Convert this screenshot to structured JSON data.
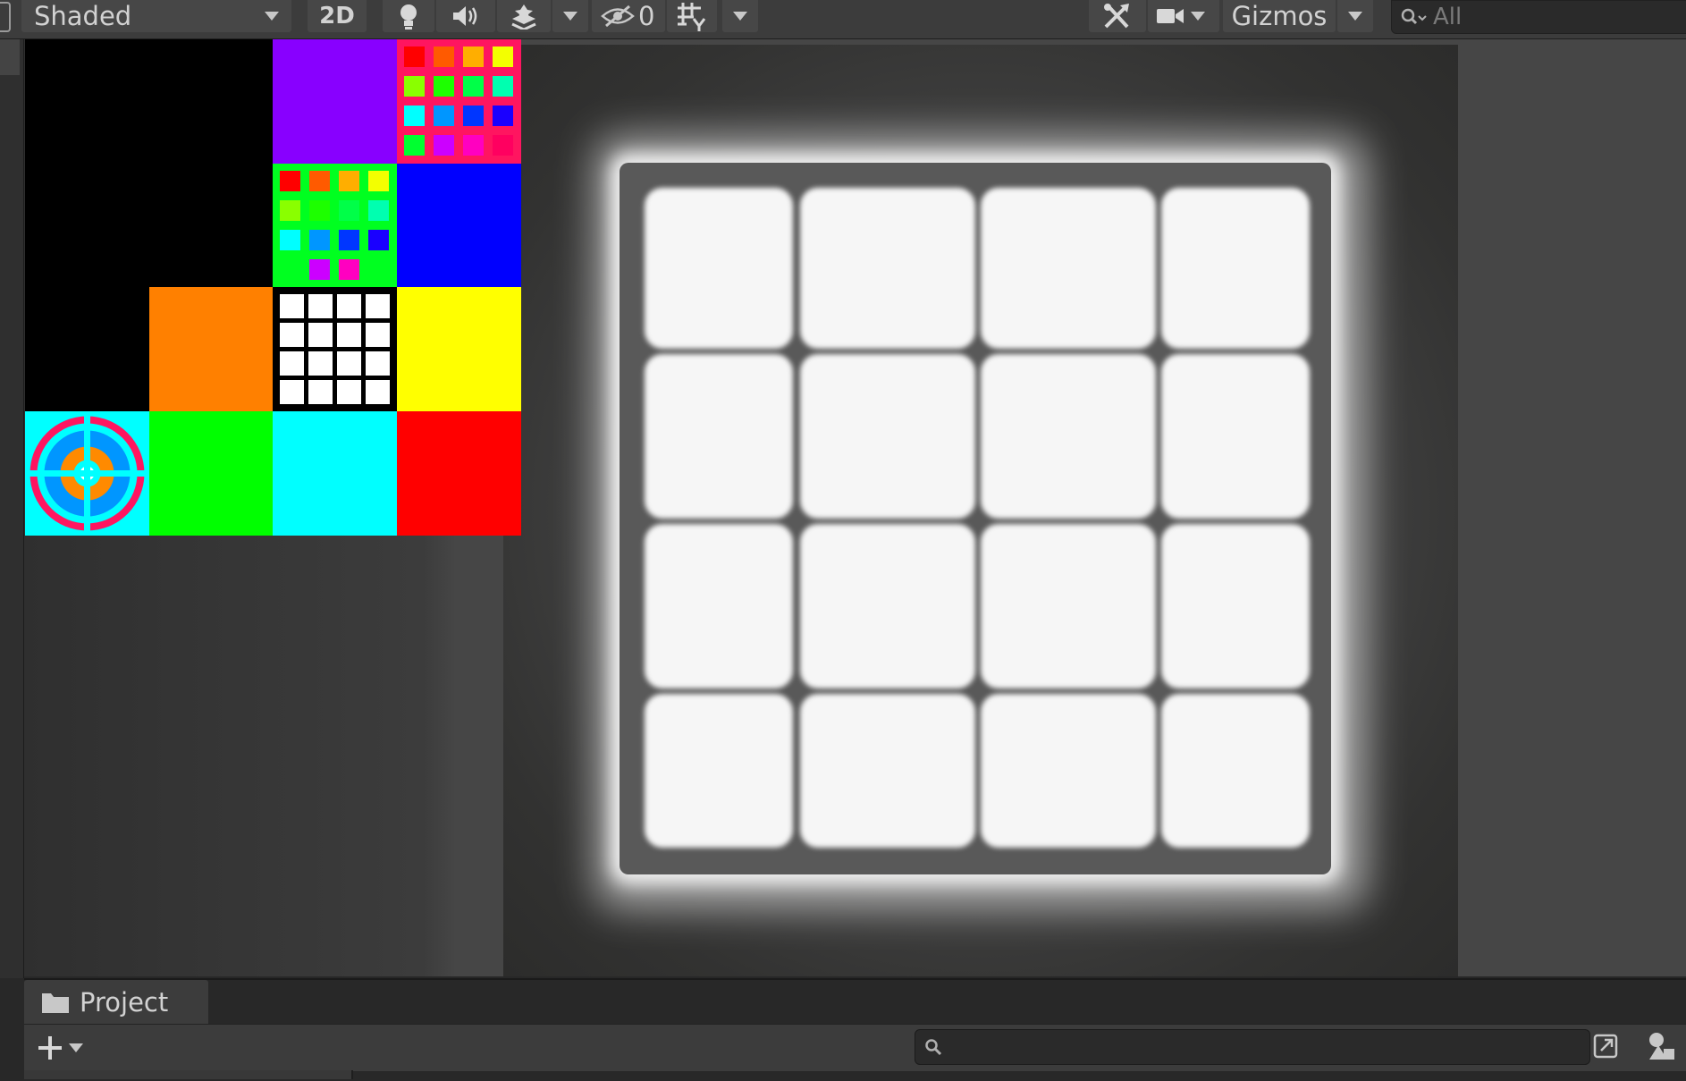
{
  "toolbar": {
    "draw_mode": "Shaded",
    "mode_2d": "2D",
    "hidden_count": "0",
    "gizmos": "Gizmos",
    "search_placeholder": "All"
  },
  "project_panel": {
    "tab_label": "Project",
    "search_placeholder": ""
  },
  "texture_atlas": {
    "colors": {
      "black": "#000000",
      "purple": "#8800ff",
      "blue": "#0000ff",
      "orange": "#ff8000",
      "yellow": "#ffff00",
      "cyan": "#00ffff",
      "green": "#00ff00",
      "red": "#ff0000",
      "pink": "#ff1560"
    },
    "palette_swatches": [
      "#ff0000",
      "#ff5a00",
      "#ffae00",
      "#f3ff00",
      "#8aff00",
      "#1dff00",
      "#00ff48",
      "#00ffb0",
      "#00ffff",
      "#0096ff",
      "#0036ff",
      "#1a00ff",
      "#00ff30",
      "#cc00ff",
      "#ff00c0",
      "#ff0060"
    ]
  }
}
